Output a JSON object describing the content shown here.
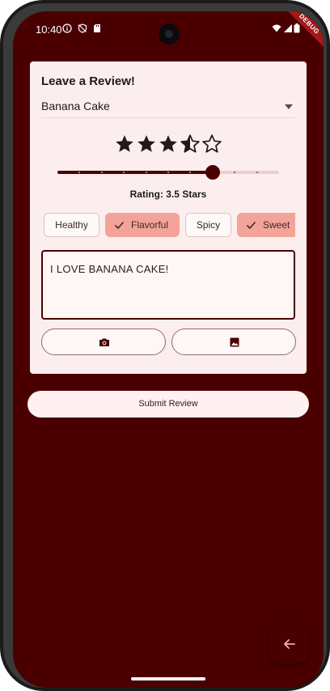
{
  "status_bar": {
    "time": "10:40",
    "icons": [
      "info-icon",
      "shield-off-icon",
      "sd-card-icon",
      "wifi-icon",
      "signal-icon",
      "battery-icon"
    ],
    "debug_banner": "DEBUG"
  },
  "review_card": {
    "title": "Leave a Review!",
    "dropdown": {
      "selected": "Banana Cake",
      "icon": "arrow-drop-down-icon"
    },
    "rating": {
      "value": 3.5,
      "max": 5,
      "slider_value_fraction": 0.7,
      "label": "Rating: 3.5 Stars"
    },
    "chips": [
      {
        "label": "Healthy",
        "selected": false
      },
      {
        "label": "Flavorful",
        "selected": true
      },
      {
        "label": "Spicy",
        "selected": false
      },
      {
        "label": "Sweet",
        "selected": true
      }
    ],
    "review_text": "I LOVE BANANA CAKE!",
    "camera_button_icon": "camera-icon",
    "gallery_button_icon": "image-icon"
  },
  "submit_button": {
    "label": "Submit Review"
  },
  "fab": {
    "icon": "arrow-back-icon"
  },
  "colors": {
    "background": "#4a0000",
    "card": "#fceeee",
    "chip_selected": "#f4a399",
    "accent": "#4a0000",
    "text": "#201a1a"
  }
}
